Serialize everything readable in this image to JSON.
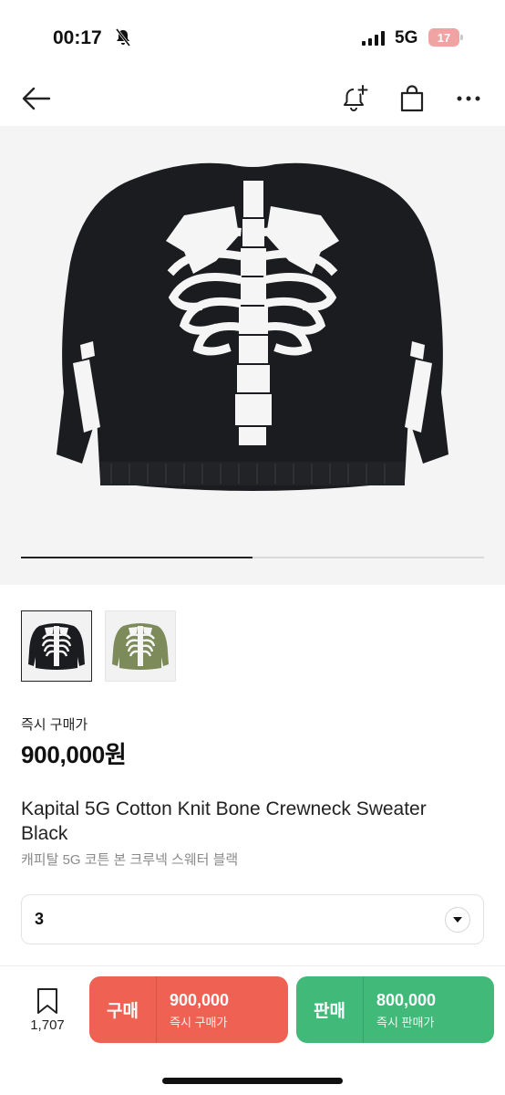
{
  "status_bar": {
    "time": "00:17",
    "network": "5G",
    "battery": "17"
  },
  "nav": {
    "back_icon": "arrow-left-icon",
    "alert_icon": "bell-plus-icon",
    "bag_icon": "shopping-bag-icon",
    "more_icon": "more-horizontal-icon"
  },
  "gallery": {
    "progress_fraction": 0.5
  },
  "thumbnails": [
    {
      "name": "black-sweater",
      "color": "#1c1c1c",
      "selected": true
    },
    {
      "name": "olive-sweater",
      "color": "#7d8a5a",
      "selected": false
    }
  ],
  "price": {
    "label": "즉시 구매가",
    "value": "900,000원"
  },
  "product": {
    "title": "Kapital 5G Cotton Knit Bone Crewneck Sweater Black",
    "subtitle": "캐피탈 5G 코튼 본 크루넥 스웨터 블랙"
  },
  "size_select": {
    "value": "3"
  },
  "bottom_bar": {
    "wish_count": "1,707",
    "buy": {
      "label": "구매",
      "price": "900,000",
      "sub": "즉시 구매가",
      "color": "#ef6253"
    },
    "sell": {
      "label": "판매",
      "price": "800,000",
      "sub": "즉시 판매가",
      "color": "#41b979"
    }
  }
}
